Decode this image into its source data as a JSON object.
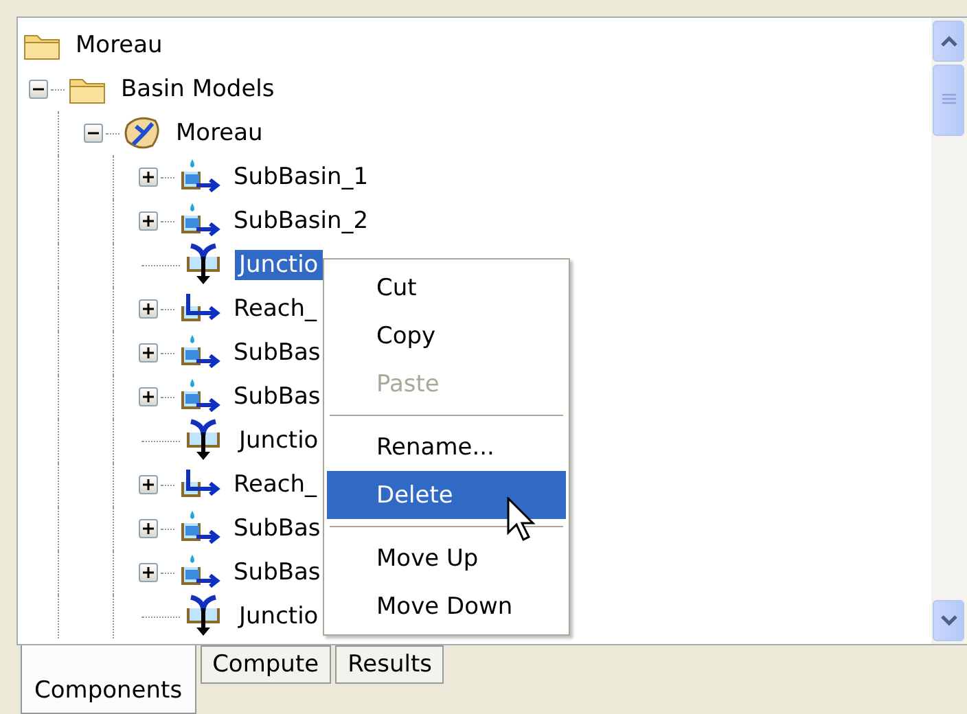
{
  "tree": [
    {
      "label": "Moreau",
      "kind": "folder",
      "selected": false,
      "children": [
        {
          "label": "Basin Models",
          "kind": "folder",
          "expanded": true,
          "selected": false,
          "children": [
            {
              "label": "Moreau",
              "kind": "basin",
              "expanded": true,
              "selected": false,
              "children": [
                {
                  "label": "SubBasin_1",
                  "kind": "subbasin",
                  "expanded": false,
                  "selected": false
                },
                {
                  "label": "SubBasin_2",
                  "kind": "subbasin",
                  "expanded": false,
                  "selected": false
                },
                {
                  "label": "Junctio",
                  "kind": "junction",
                  "selected": true
                },
                {
                  "label": "Reach_",
                  "kind": "reach",
                  "expanded": false,
                  "selected": false
                },
                {
                  "label": "SubBas",
                  "kind": "subbasin",
                  "expanded": false,
                  "selected": false
                },
                {
                  "label": "SubBas",
                  "kind": "subbasin",
                  "expanded": false,
                  "selected": false
                },
                {
                  "label": "Junctio",
                  "kind": "junction",
                  "selected": false
                },
                {
                  "label": "Reach_",
                  "kind": "reach",
                  "expanded": false,
                  "selected": false
                },
                {
                  "label": "SubBas",
                  "kind": "subbasin",
                  "expanded": false,
                  "selected": false
                },
                {
                  "label": "SubBas",
                  "kind": "subbasin",
                  "expanded": false,
                  "selected": false
                },
                {
                  "label": "Junctio",
                  "kind": "junction",
                  "selected": false
                }
              ]
            }
          ]
        }
      ]
    }
  ],
  "context_menu": [
    {
      "kind": "item",
      "label": "Cut",
      "disabled": false,
      "selected": false
    },
    {
      "kind": "item",
      "label": "Copy",
      "disabled": false,
      "selected": false
    },
    {
      "kind": "item",
      "label": "Paste",
      "disabled": true,
      "selected": false
    },
    {
      "kind": "separator"
    },
    {
      "kind": "item",
      "label": "Rename...",
      "disabled": false,
      "selected": false
    },
    {
      "kind": "item",
      "label": "Delete",
      "disabled": false,
      "selected": true
    },
    {
      "kind": "separator"
    },
    {
      "kind": "item",
      "label": "Move Up",
      "disabled": false,
      "selected": false
    },
    {
      "kind": "item",
      "label": "Move Down",
      "disabled": false,
      "selected": false
    }
  ],
  "tabs": [
    {
      "label": "Components",
      "selected": true
    },
    {
      "label": "Compute",
      "selected": false
    },
    {
      "label": "Results",
      "selected": false
    }
  ]
}
